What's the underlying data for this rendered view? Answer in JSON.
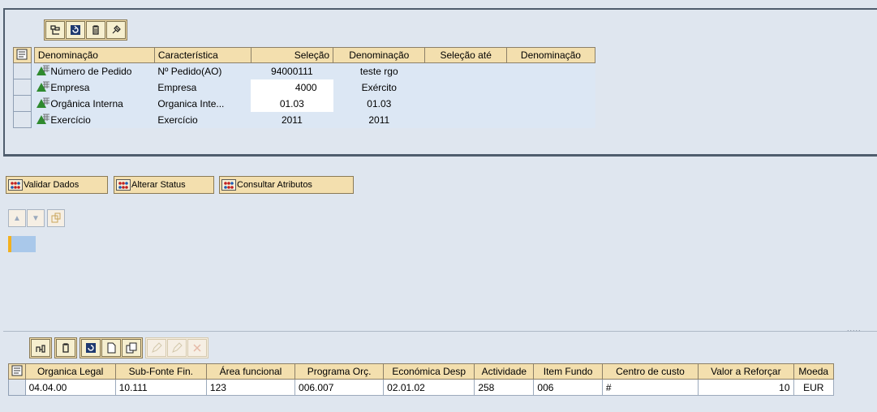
{
  "selection_grid": {
    "columns": [
      "Denominação",
      "Característica",
      "Seleção",
      "Denominação",
      "Seleção até",
      "Denominação"
    ],
    "rows": [
      {
        "denominacao": "Número de Pedido",
        "caracteristica": "Nº Pedido(AO)",
        "selecao": "94000111",
        "denominacao2": "teste rgo",
        "selecao_ate": "",
        "denominacao3": ""
      },
      {
        "denominacao": "Empresa",
        "caracteristica": "Empresa",
        "selecao": "4000",
        "denominacao2": "Exército",
        "selecao_ate": "",
        "denominacao3": ""
      },
      {
        "denominacao": "Orgânica Interna",
        "caracteristica": "Organica Inte...",
        "selecao": "01.03",
        "denominacao2": "01.03",
        "selecao_ate": "",
        "denominacao3": ""
      },
      {
        "denominacao": "Exercício",
        "caracteristica": "Exercício",
        "selecao": "2011",
        "denominacao2": "2011",
        "selecao_ate": "",
        "denominacao3": ""
      }
    ]
  },
  "actions": {
    "validar": "Validar Dados",
    "alterar": "Alterar Status",
    "consultar": "Consultar Atributos"
  },
  "item_grid": {
    "columns": [
      "Organica Legal",
      "Sub-Fonte Fin.",
      "Área funcional",
      "Programa Orç.",
      "Económica Desp",
      "Actividade",
      "Item Fundo",
      "Centro de custo",
      "Valor a Reforçar",
      "Moeda"
    ],
    "rows": [
      {
        "organica_legal": "04.04.00",
        "sub_fonte": "10.111",
        "area_funcional": "123",
        "programa": "006.007",
        "economica": "02.01.02",
        "actividade": "258",
        "item_fundo": "006",
        "centro_custo": "#",
        "valor": "10",
        "moeda": "EUR"
      }
    ]
  },
  "splitter_dots": ".....",
  "colors": {
    "header": "#f3dfae",
    "panel": "#dfe6ef",
    "selection_blue": "#dce7f4"
  }
}
